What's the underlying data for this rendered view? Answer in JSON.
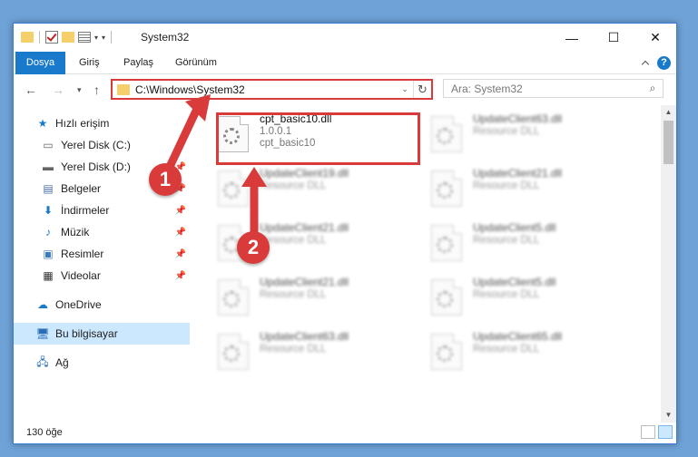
{
  "window": {
    "title": "System32",
    "controls": {
      "minimize": "—",
      "maximize": "☐",
      "close": "✕"
    }
  },
  "ribbon": {
    "tabs": [
      "Dosya",
      "Giriş",
      "Paylaş",
      "Görünüm"
    ],
    "help": "?"
  },
  "navigation": {
    "address": "C:\\Windows\\System32",
    "search_placeholder": "Ara: System32"
  },
  "sidebar": {
    "items": [
      {
        "label": "Hızlı erişim",
        "icon": "star-icon"
      },
      {
        "label": "Yerel Disk (C:)",
        "icon": "drive-icon",
        "pinned": true
      },
      {
        "label": "Yerel Disk (D:)",
        "icon": "drive-icon",
        "pinned": true
      },
      {
        "label": "Belgeler",
        "icon": "document-icon",
        "pinned": true
      },
      {
        "label": "İndirmeler",
        "icon": "download-icon",
        "pinned": true
      },
      {
        "label": "Müzik",
        "icon": "music-icon",
        "pinned": true
      },
      {
        "label": "Resimler",
        "icon": "pictures-icon",
        "pinned": true
      },
      {
        "label": "Videolar",
        "icon": "video-icon",
        "pinned": true
      },
      {
        "label": "OneDrive",
        "icon": "cloud-icon"
      },
      {
        "label": "Bu bilgisayar",
        "icon": "computer-icon",
        "selected": true
      },
      {
        "label": "Ağ",
        "icon": "network-icon"
      }
    ]
  },
  "files": [
    {
      "name": "cpt_basic10.dll",
      "line2": "1.0.0.1",
      "line3": "cpt_basic10",
      "focused": true
    },
    {
      "name": "UpdateClient63.dll",
      "line2": "Resource DLL"
    },
    {
      "name": "UpdateClient19.dll",
      "line2": "Resource DLL"
    },
    {
      "name": "UpdateClient21.dll",
      "line2": "Resource DLL"
    },
    {
      "name": "UpdateClient21.dll",
      "line2": "Resource DLL"
    },
    {
      "name": "UpdateClient5.dll",
      "line2": "Resource DLL"
    },
    {
      "name": "UpdateClient21.dll",
      "line2": "Resource DLL"
    },
    {
      "name": "UpdateClient5.dll",
      "line2": "Resource DLL"
    },
    {
      "name": "UpdateClient63.dll",
      "line2": "Resource DLL"
    },
    {
      "name": "UpdateClient65.dll",
      "line2": "Resource DLL"
    }
  ],
  "status": {
    "count": "130 öğe"
  },
  "callouts": [
    "1",
    "2"
  ],
  "colors": {
    "accent": "#1979ca",
    "highlight": "#d93a3a",
    "folder": "#f4cf6a"
  }
}
